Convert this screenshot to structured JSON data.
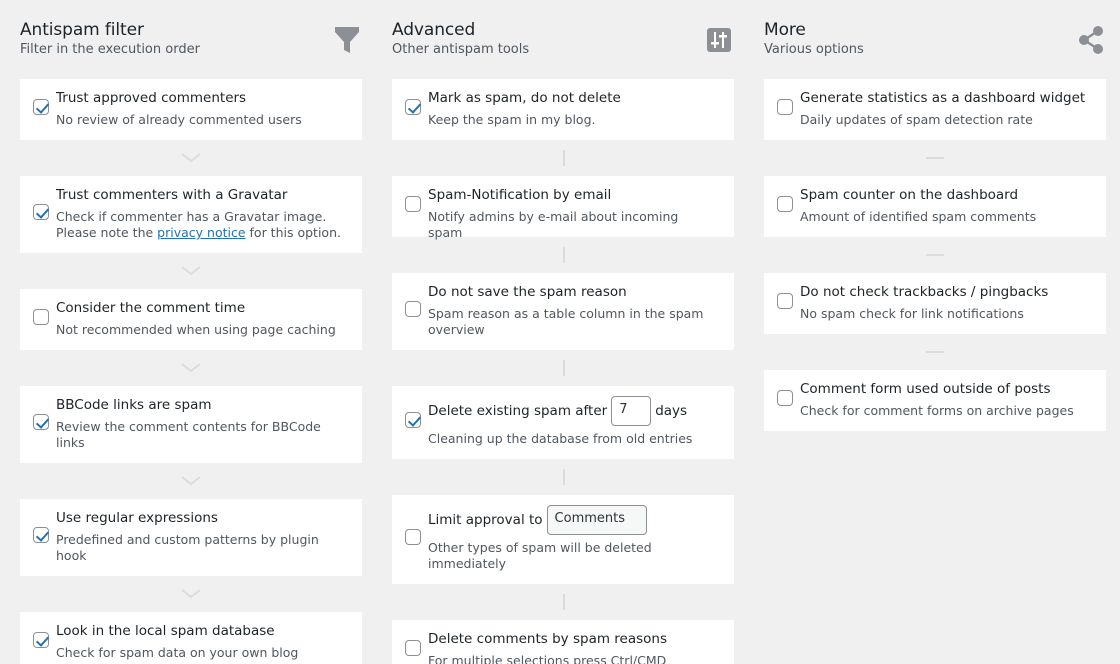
{
  "columns": {
    "filter": {
      "title": "Antispam filter",
      "subtitle": "Filter in the execution order",
      "icon": "funnel-icon",
      "items": [
        {
          "label": "Trust approved commenters",
          "desc": "No review of already commented users",
          "checked": true
        },
        {
          "label": "Trust commenters with a Gravatar",
          "desc": "Check if commenter has a Gravatar image. Please note the",
          "link": "privacy notice",
          "desc_after": "for this option.",
          "checked": true
        },
        {
          "label": "Consider the comment time",
          "desc": "Not recommended when using page caching",
          "checked": false
        },
        {
          "label": "BBCode links are spam",
          "desc": "Review the comment contents for BBCode links",
          "checked": true
        },
        {
          "label": "Use regular expressions",
          "desc": "Predefined and custom patterns by plugin hook",
          "checked": true
        },
        {
          "label": "Look in the local spam database",
          "desc": "Check for spam data on your own blog",
          "checked": true
        }
      ]
    },
    "advanced": {
      "title": "Advanced",
      "subtitle": "Other antispam tools",
      "icon": "sliders-icon",
      "items": [
        {
          "label": "Mark as spam, do not delete",
          "desc": "Keep the spam in my blog.",
          "checked": true
        },
        {
          "label": "Spam-Notification by email",
          "desc": "Notify admins by e-mail about incoming spam",
          "checked": false
        },
        {
          "label": "Do not save the spam reason",
          "desc": "Spam reason as a table column in the spam overview",
          "checked": false
        },
        {
          "label": "Delete existing spam after",
          "input_value": "7",
          "label_after": "days",
          "desc": "Cleaning up the database from old entries",
          "checked": true
        },
        {
          "label": "Limit approval to",
          "select_value": "Comments",
          "desc": "Other types of spam will be deleted immediately",
          "checked": false
        },
        {
          "label": "Delete comments by spam reasons",
          "desc": "For multiple selections press Ctrl/CMD",
          "checked": false
        }
      ]
    },
    "more": {
      "title": "More",
      "subtitle": "Various options",
      "icon": "share-icon",
      "items": [
        {
          "label": "Generate statistics as a dashboard widget",
          "desc": "Daily updates of spam detection rate",
          "checked": false
        },
        {
          "label": "Spam counter on the dashboard",
          "desc": "Amount of identified spam comments",
          "checked": false
        },
        {
          "label": "Do not check trackbacks / pingbacks",
          "desc": "No spam check for link notifications",
          "checked": false
        },
        {
          "label": "Comment form used outside of posts",
          "desc": "Check for comment forms on archive pages",
          "checked": false
        }
      ]
    }
  },
  "colors": {
    "background": "#f0f0f1",
    "card": "#ffffff",
    "accent": "#2271b1",
    "muted_icon": "#8c8f94"
  }
}
